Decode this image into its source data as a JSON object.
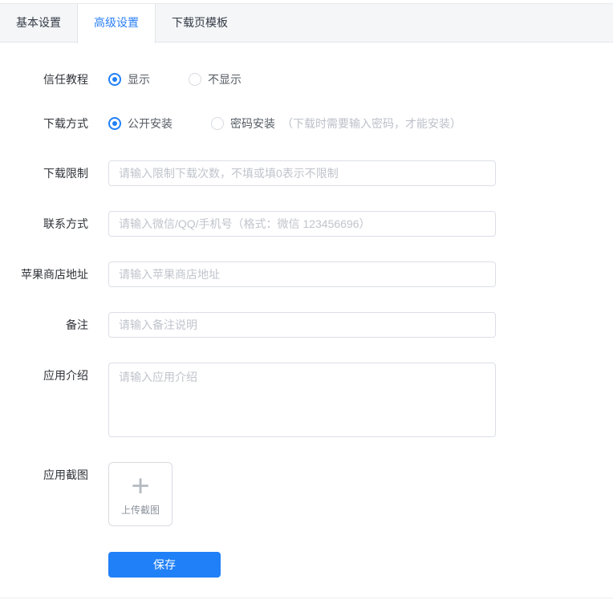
{
  "tabs": [
    {
      "label": "基本设置",
      "active": false
    },
    {
      "label": "高级设置",
      "active": true
    },
    {
      "label": "下载页模板",
      "active": false
    }
  ],
  "form": {
    "trust_tutorial": {
      "label": "信任教程",
      "options": [
        {
          "label": "显示",
          "selected": true
        },
        {
          "label": "不显示",
          "selected": false
        }
      ]
    },
    "download_method": {
      "label": "下载方式",
      "options": [
        {
          "label": "公开安装",
          "selected": true
        },
        {
          "label": "密码安装",
          "selected": false
        }
      ],
      "hint": "（下载时需要输入密码，才能安装）"
    },
    "download_limit": {
      "label": "下载限制",
      "value": "",
      "placeholder": "请输入限制下载次数，不填或填0表示不限制"
    },
    "contact": {
      "label": "联系方式",
      "value": "",
      "placeholder": "请输入微信/QQ/手机号（格式：微信 123456696）"
    },
    "apple_store": {
      "label": "苹果商店地址",
      "value": "",
      "placeholder": "请输入苹果商店地址"
    },
    "remark": {
      "label": "备注",
      "value": "",
      "placeholder": "请输入备注说明"
    },
    "app_intro": {
      "label": "应用介绍",
      "value": "",
      "placeholder": "请输入应用介绍"
    },
    "app_screenshot": {
      "label": "应用截图",
      "plus_icon": "+",
      "upload_text": "上传截图"
    },
    "save_label": "保存"
  },
  "colors": {
    "primary": "#2080f7",
    "tab_bar_bg": "#f5f6f8",
    "border": "#dcdfe6",
    "placeholder": "#c0c4cc"
  }
}
